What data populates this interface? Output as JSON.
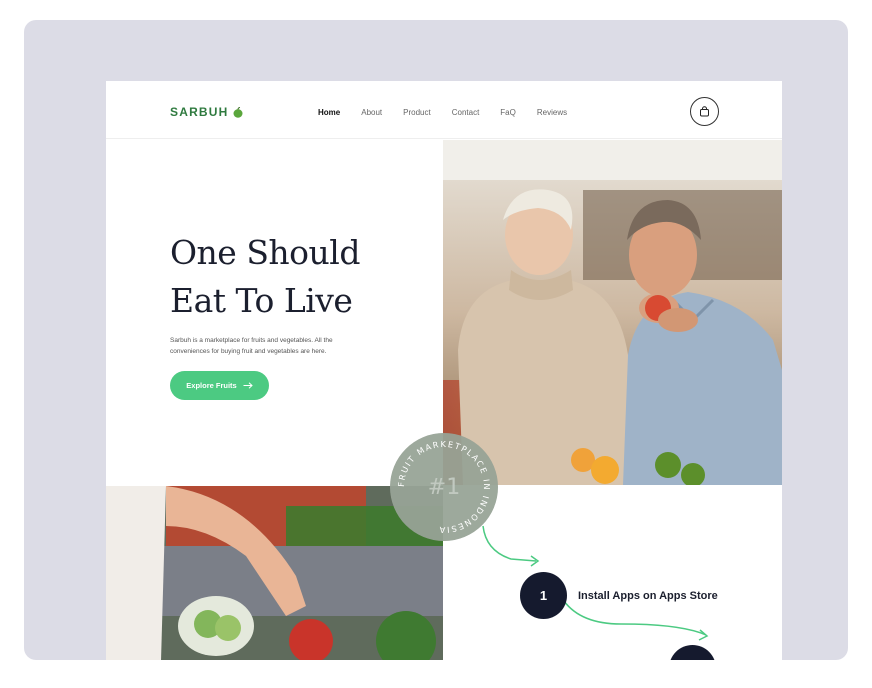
{
  "brand": {
    "name": "SARBUH",
    "accent": "#2f7a3f",
    "cta_color": "#4cca82"
  },
  "nav": {
    "items": [
      {
        "label": "Home",
        "active": true
      },
      {
        "label": "About"
      },
      {
        "label": "Product"
      },
      {
        "label": "Contact"
      },
      {
        "label": "FaQ"
      },
      {
        "label": "Reviews"
      }
    ],
    "cart_icon": "shopping-bag-icon"
  },
  "hero": {
    "title_line1": "One Should",
    "title_line2": "Eat To Live",
    "description": "Sarbuh is a marketplace for fruits and vegetables. All the conveniences for buying fruit and vegetables are here.",
    "cta_label": "Explore Fruits",
    "cta_icon": "arrow-right-icon"
  },
  "badge": {
    "number": "#1",
    "ring_text": "FRUIT MARKETPLACE IN INDONESIA "
  },
  "steps": [
    {
      "number": "1",
      "label": "Install Apps on Apps Store"
    }
  ]
}
